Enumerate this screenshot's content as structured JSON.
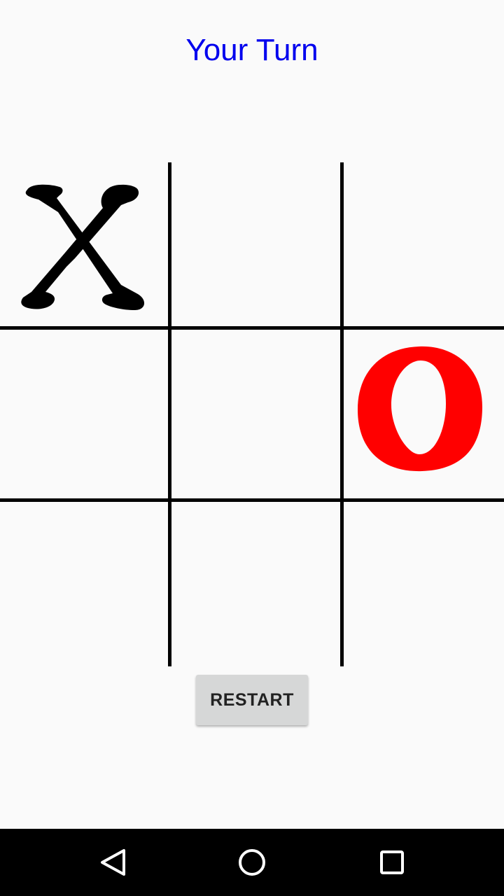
{
  "status": {
    "text": "Your Turn",
    "color": "#0000ee"
  },
  "board": {
    "cells": [
      [
        "X",
        "",
        ""
      ],
      [
        "",
        "",
        "O"
      ],
      [
        "",
        "",
        ""
      ]
    ],
    "x_color": "#000000",
    "o_color": "#ff0000",
    "line_color": "#000000"
  },
  "restart_button": {
    "label": "RESTART"
  },
  "nav_bar": {
    "buttons": [
      "back-icon",
      "home-icon",
      "recents-icon"
    ]
  }
}
